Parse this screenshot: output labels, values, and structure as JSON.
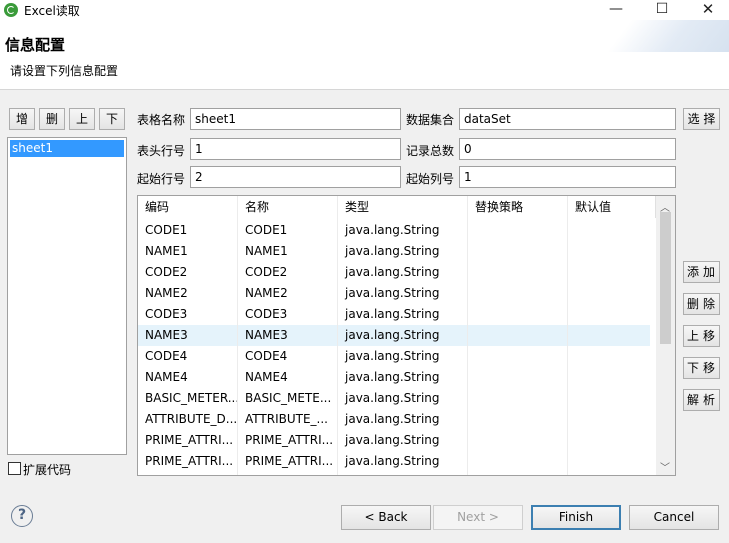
{
  "window": {
    "title": "Excel读取",
    "minimize": "—",
    "maximize": "☐",
    "close": "✕"
  },
  "banner": {
    "title": "信息配置",
    "subtitle": "请设置下列信息配置"
  },
  "sheet_panel": {
    "buttons": [
      "增",
      "删",
      "上",
      "下"
    ],
    "items": [
      "sheet1"
    ],
    "extend_code_label": "扩展代码"
  },
  "form": {
    "table_name_label": "表格名称",
    "table_name_value": "sheet1",
    "dataset_label": "数据集合",
    "dataset_value": "dataSet",
    "select_button": "选 择",
    "header_row_label": "表头行号",
    "header_row_value": "1",
    "record_total_label": "记录总数",
    "record_total_value": "0",
    "start_row_label": "起始行号",
    "start_row_value": "2",
    "start_col_label": "起始列号",
    "start_col_value": "1"
  },
  "table": {
    "columns": [
      "编码",
      "名称",
      "类型",
      "替换策略",
      "默认值"
    ],
    "selected_row": 5,
    "rows": [
      [
        "CODE1",
        "CODE1",
        "java.lang.String",
        "",
        ""
      ],
      [
        "NAME1",
        "NAME1",
        "java.lang.String",
        "",
        ""
      ],
      [
        "CODE2",
        "CODE2",
        "java.lang.String",
        "",
        ""
      ],
      [
        "NAME2",
        "NAME2",
        "java.lang.String",
        "",
        ""
      ],
      [
        "CODE3",
        "CODE3",
        "java.lang.String",
        "",
        ""
      ],
      [
        "NAME3",
        "NAME3",
        "java.lang.String",
        "",
        ""
      ],
      [
        "CODE4",
        "CODE4",
        "java.lang.String",
        "",
        ""
      ],
      [
        "NAME4",
        "NAME4",
        "java.lang.String",
        "",
        ""
      ],
      [
        "BASIC_METER...",
        "BASIC_METE...",
        "java.lang.String",
        "",
        ""
      ],
      [
        "ATTRIBUTE_D...",
        "ATTRIBUTE_...",
        "java.lang.String",
        "",
        ""
      ],
      [
        "PRIME_ATTRI...",
        "PRIME_ATTRI...",
        "java.lang.String",
        "",
        ""
      ],
      [
        "PRIME_ATTRI...",
        "PRIME_ATTRI...",
        "java.lang.String",
        "",
        ""
      ]
    ],
    "scroll_up": "︿",
    "scroll_down": "﹀"
  },
  "right_buttons": [
    "添加",
    "删除",
    "上移",
    "下移",
    "解析"
  ],
  "footer": {
    "help": "?",
    "back": "< Back",
    "next": "Next >",
    "finish": "Finish",
    "cancel": "Cancel"
  }
}
